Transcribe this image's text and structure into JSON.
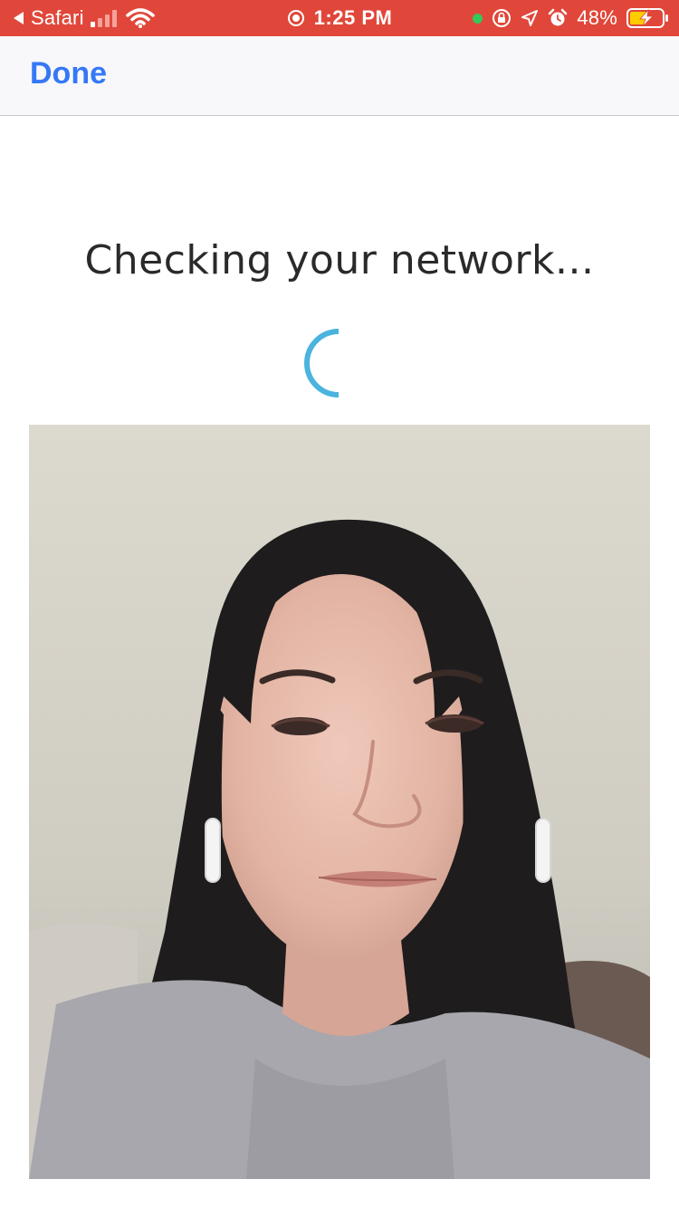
{
  "status_bar": {
    "back_app": "Safari",
    "time": "1:25 PM",
    "battery_percent": "48%",
    "colors": {
      "background": "#e0473a",
      "indicator_dot": "#34c759"
    },
    "icons": [
      "back-arrow-icon",
      "cellular-signal-icon",
      "wifi-icon",
      "screen-recording-icon",
      "orientation-lock-icon",
      "location-icon",
      "alarm-icon",
      "battery-charging-icon"
    ]
  },
  "nav": {
    "done_label": "Done",
    "accent_color": "#3478f6"
  },
  "main": {
    "title": "Checking your network...",
    "spinner_color": "#4ab3de",
    "camera_preview_icon": "person-photo"
  }
}
